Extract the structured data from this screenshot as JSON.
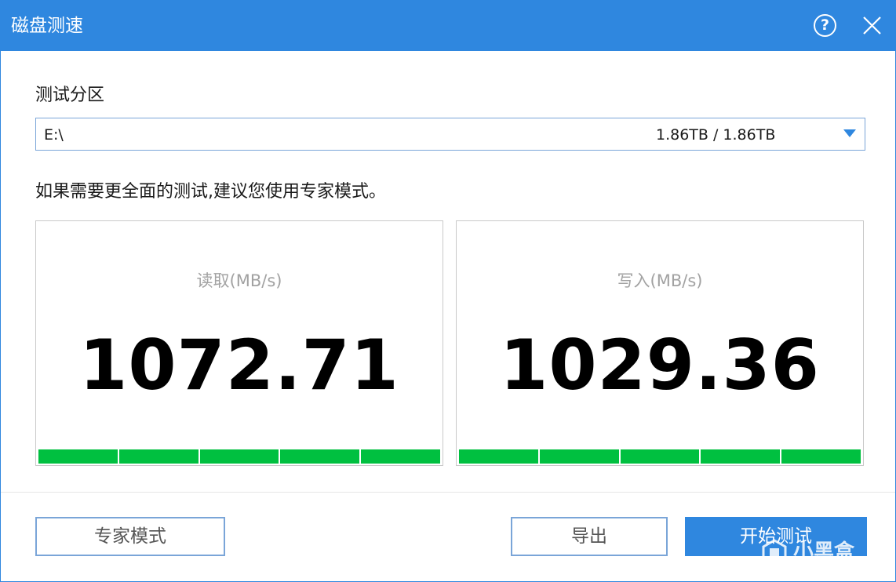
{
  "window": {
    "title": "磁盘测速",
    "help_symbol": "?"
  },
  "partition": {
    "label": "测试分区",
    "selected_value": "E:\\",
    "size_text": "1.86TB / 1.86TB"
  },
  "hint_text": "如果需要更全面的测试,建议您使用专家模式。",
  "results": {
    "read": {
      "label": "读取(MB/s)",
      "value": "1072.71",
      "progress": 1.0
    },
    "write": {
      "label": "写入(MB/s)",
      "value": "1029.36",
      "progress": 1.0
    }
  },
  "buttons": {
    "expert_mode": "专家模式",
    "export": "导出",
    "start_test": "开始测试"
  },
  "watermark": {
    "text": "小黑盒"
  },
  "colors": {
    "accent": "#2f87df",
    "progress": "#00c040",
    "muted_label": "#a2a2a2"
  },
  "icons": {
    "help": "help-icon",
    "close": "close-icon",
    "dropdown": "chevron-down-icon"
  }
}
